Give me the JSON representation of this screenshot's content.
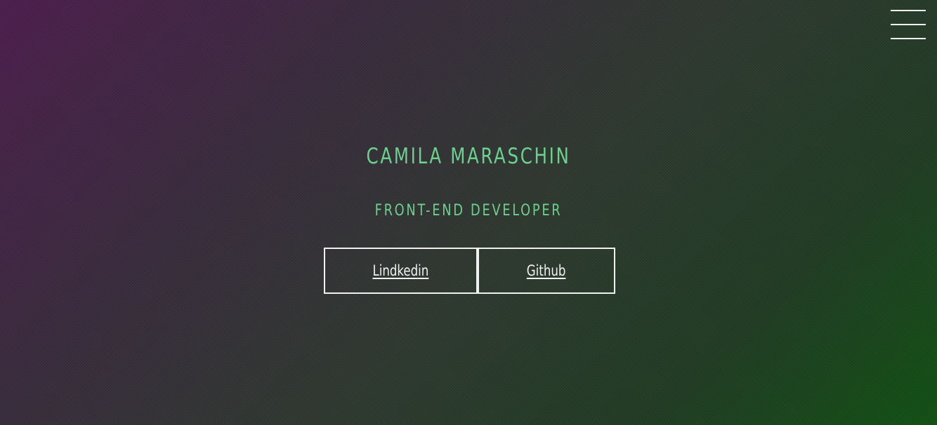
{
  "header": {
    "menu_icon": "hamburger-menu-icon"
  },
  "hero": {
    "name": "CAMILA MARASCHIN",
    "role": "FRONT-END DEVELOPER"
  },
  "links": [
    {
      "label": "Lindkedin"
    },
    {
      "label": "Github"
    }
  ],
  "colors": {
    "accent": "#6cd08e",
    "text_light": "#f2f2f2",
    "gradient_start": "#4e1f4f",
    "gradient_end": "#125214"
  }
}
